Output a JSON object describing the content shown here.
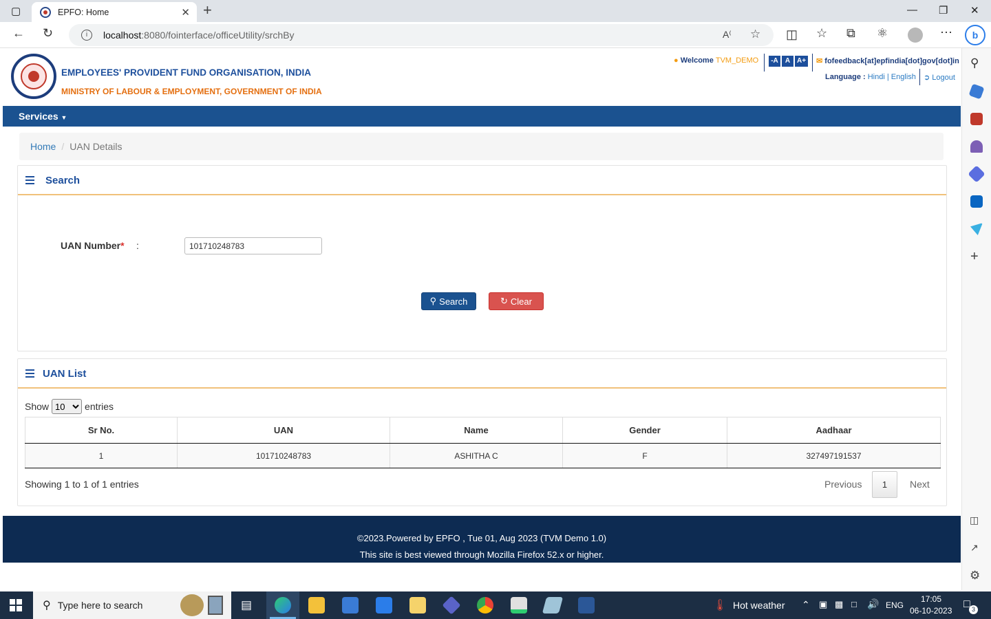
{
  "browser": {
    "tab_title": "EPFO: Home",
    "url_host": "localhost",
    "url_path": ":8080/fointerface/officeUtility/srchBy"
  },
  "header": {
    "org_name": "EMPLOYEES' PROVIDENT FUND ORGANISATION, INDIA",
    "ministry": "MINISTRY OF LABOUR & EMPLOYMENT, GOVERNMENT OF INDIA",
    "welcome_label": "Welcome",
    "username": "TVM_DEMO",
    "font_small": "-A",
    "font_normal": "A",
    "font_large": "A+",
    "feedback_email": "fofeedback[at]epfindia[dot]gov[dot]in",
    "language_label": "Language :",
    "lang_hindi": "Hindi",
    "lang_sep": "|",
    "lang_english": "English",
    "logout": "Logout"
  },
  "nav": {
    "services": "Services"
  },
  "breadcrumb": {
    "home": "Home",
    "sep": "/",
    "current": "UAN Details"
  },
  "search_panel": {
    "title": "Search",
    "uan_label": "UAN Number",
    "required_mark": "*",
    "colon": ":",
    "uan_value": "101710248783",
    "search_btn": "Search",
    "clear_btn": "Clear"
  },
  "list_panel": {
    "title": "UAN List",
    "show_label": "Show",
    "entries_label": "entries",
    "page_size": "10",
    "columns": [
      "Sr No.",
      "UAN",
      "Name",
      "Gender",
      "Aadhaar"
    ],
    "rows": [
      [
        "1",
        "101710248783",
        "ASHITHA C",
        "F",
        "327497191537"
      ]
    ],
    "showing": "Showing 1 to 1 of 1 entries",
    "prev": "Previous",
    "page": "1",
    "next": "Next"
  },
  "footer": {
    "line1": "©2023.Powered by EPFO , Tue 01, Aug 2023 (TVM Demo 1.0)",
    "line2": "This site is best viewed through Mozilla Firefox 52.x or higher."
  },
  "taskbar": {
    "search_placeholder": "Type here to search",
    "weather": "Hot weather",
    "lang": "ENG",
    "time": "17:05",
    "date": "06-10-2023",
    "notif_count": "3"
  },
  "colors": {
    "brand_blue": "#1b5290",
    "footer_navy": "#0d2b52",
    "clear_red": "#d9534f",
    "accent_orange": "#e46f10"
  }
}
